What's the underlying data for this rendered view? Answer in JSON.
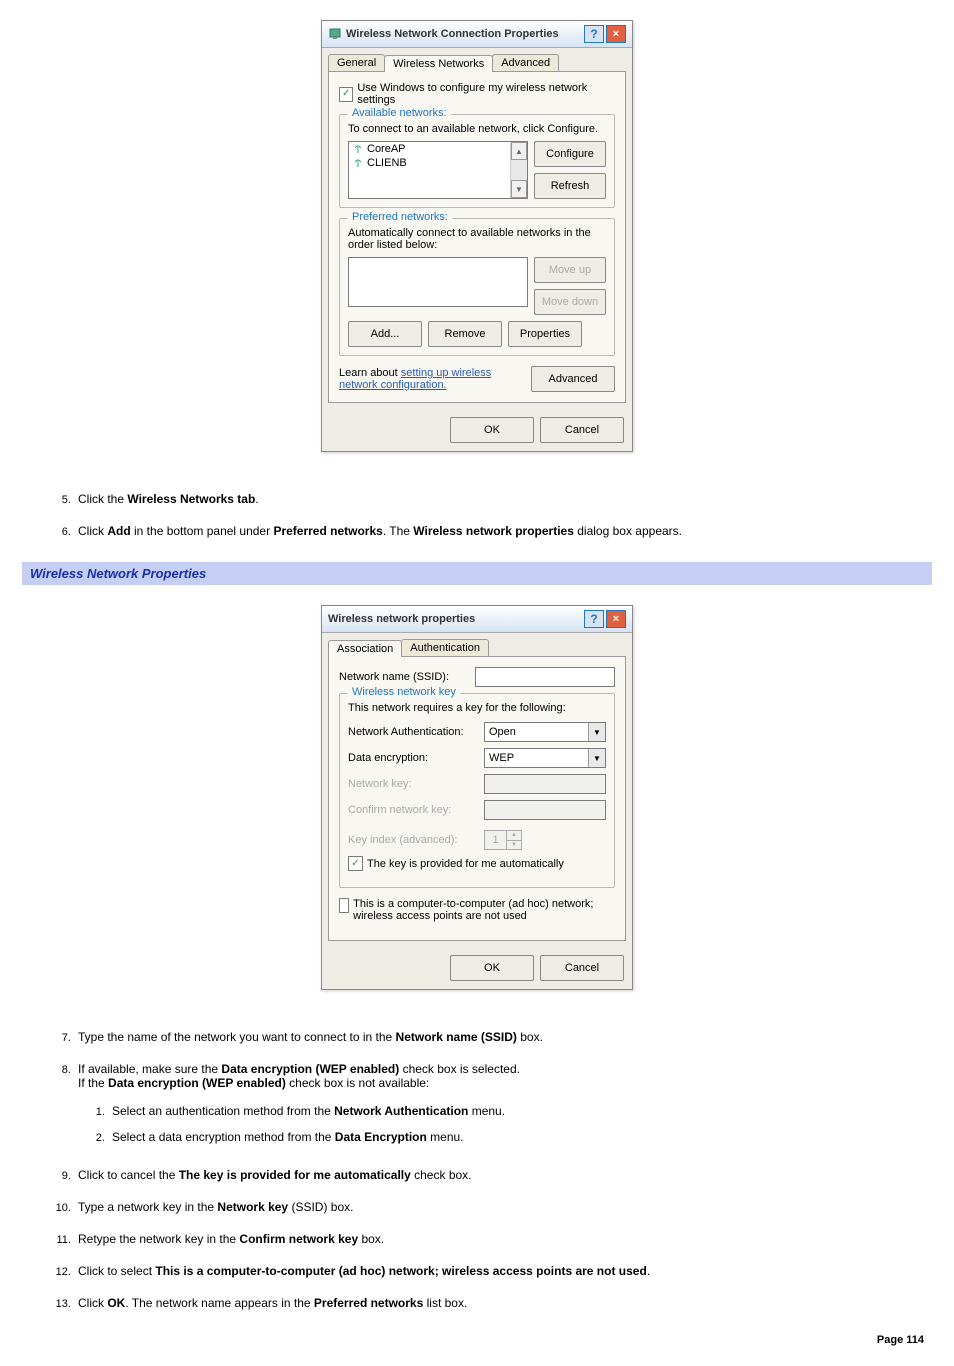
{
  "dialog1": {
    "title": "Wireless Network Connection Properties",
    "tabs": [
      "General",
      "Wireless Networks",
      "Advanced"
    ],
    "active_tab": 1,
    "use_windows_label": "Use Windows to configure my wireless network settings",
    "available": {
      "group_title": "Available networks:",
      "instruction": "To connect to an available network, click Configure.",
      "items": [
        "CoreAP",
        "CLIENB"
      ],
      "configure_btn": "Configure",
      "refresh_btn": "Refresh"
    },
    "preferred": {
      "group_title": "Preferred networks:",
      "instruction": "Automatically connect to available networks in the order listed below:",
      "moveup_btn": "Move up",
      "movedown_btn": "Move down",
      "add_btn": "Add...",
      "remove_btn": "Remove",
      "properties_btn": "Properties"
    },
    "learn_text": "Learn about ",
    "learn_link": "setting up wireless network configuration.",
    "advanced_btn": "Advanced",
    "ok": "OK",
    "cancel": "Cancel"
  },
  "instructions_a": {
    "start": 5,
    "items": [
      {
        "pre": "Click the ",
        "bold": "Wireless Networks tab",
        "post": "."
      },
      {
        "pre": "Click ",
        "bold": "Add",
        "mid": " in the bottom panel under ",
        "bold2": "Preferred networks",
        "mid2": ". The ",
        "bold3": "Wireless network properties",
        "post": " dialog box appears."
      }
    ]
  },
  "section_header": "Wireless Network Properties",
  "dialog2": {
    "title": "Wireless network properties",
    "tabs": [
      "Association",
      "Authentication"
    ],
    "active_tab": 0,
    "ssid_label": "Network name (SSID):",
    "key_group_title": "Wireless network key",
    "key_instruction": "This network requires a key for the following:",
    "auth_label": "Network Authentication:",
    "auth_value": "Open",
    "enc_label": "Data encryption:",
    "enc_value": "WEP",
    "netkey_label": "Network key:",
    "confirm_label": "Confirm network key:",
    "keyindex_label": "Key index (advanced):",
    "keyindex_value": "1",
    "autokey_label": "The key is provided for me automatically",
    "adhoc_label": "This is a computer-to-computer (ad hoc) network; wireless access points are not used",
    "ok": "OK",
    "cancel": "Cancel"
  },
  "instructions_b": {
    "step7": {
      "pre": "Type the name of the network you want to connect to in the ",
      "bold": "Network name (SSID)",
      "post": " box."
    },
    "step8a": {
      "pre": "If available, make sure the ",
      "bold": "Data encryption (WEP enabled)",
      "post": " check box is selected."
    },
    "step8b": {
      "pre": "If the ",
      "bold": "Data encryption (WEP enabled)",
      "post": " check box is not available:"
    },
    "step8_1": {
      "pre": "Select an authentication method from the ",
      "bold": "Network Authentication",
      "post": " menu."
    },
    "step8_2": {
      "pre": "Select a data encryption method from the ",
      "bold": "Data Encryption",
      "post": " menu."
    },
    "step9": {
      "pre": "Click to cancel the ",
      "bold": "The key is provided for me automatically",
      "post": " check box."
    },
    "step10": {
      "pre": "Type a network key in the ",
      "bold": "Network key",
      "post": " (SSID) box."
    },
    "step11": {
      "pre": "Retype the network key in the ",
      "bold": "Confirm network key",
      "post": " box."
    },
    "step12": {
      "pre": "Click to select ",
      "bold": "This is a computer-to-computer (ad hoc) network; wireless access points are not used",
      "post": "."
    },
    "step13": {
      "pre": "Click ",
      "bold": "OK",
      "mid": ". The network name appears in the ",
      "bold2": "Preferred networks",
      "post": " list box."
    }
  },
  "page_footer": "Page 114"
}
